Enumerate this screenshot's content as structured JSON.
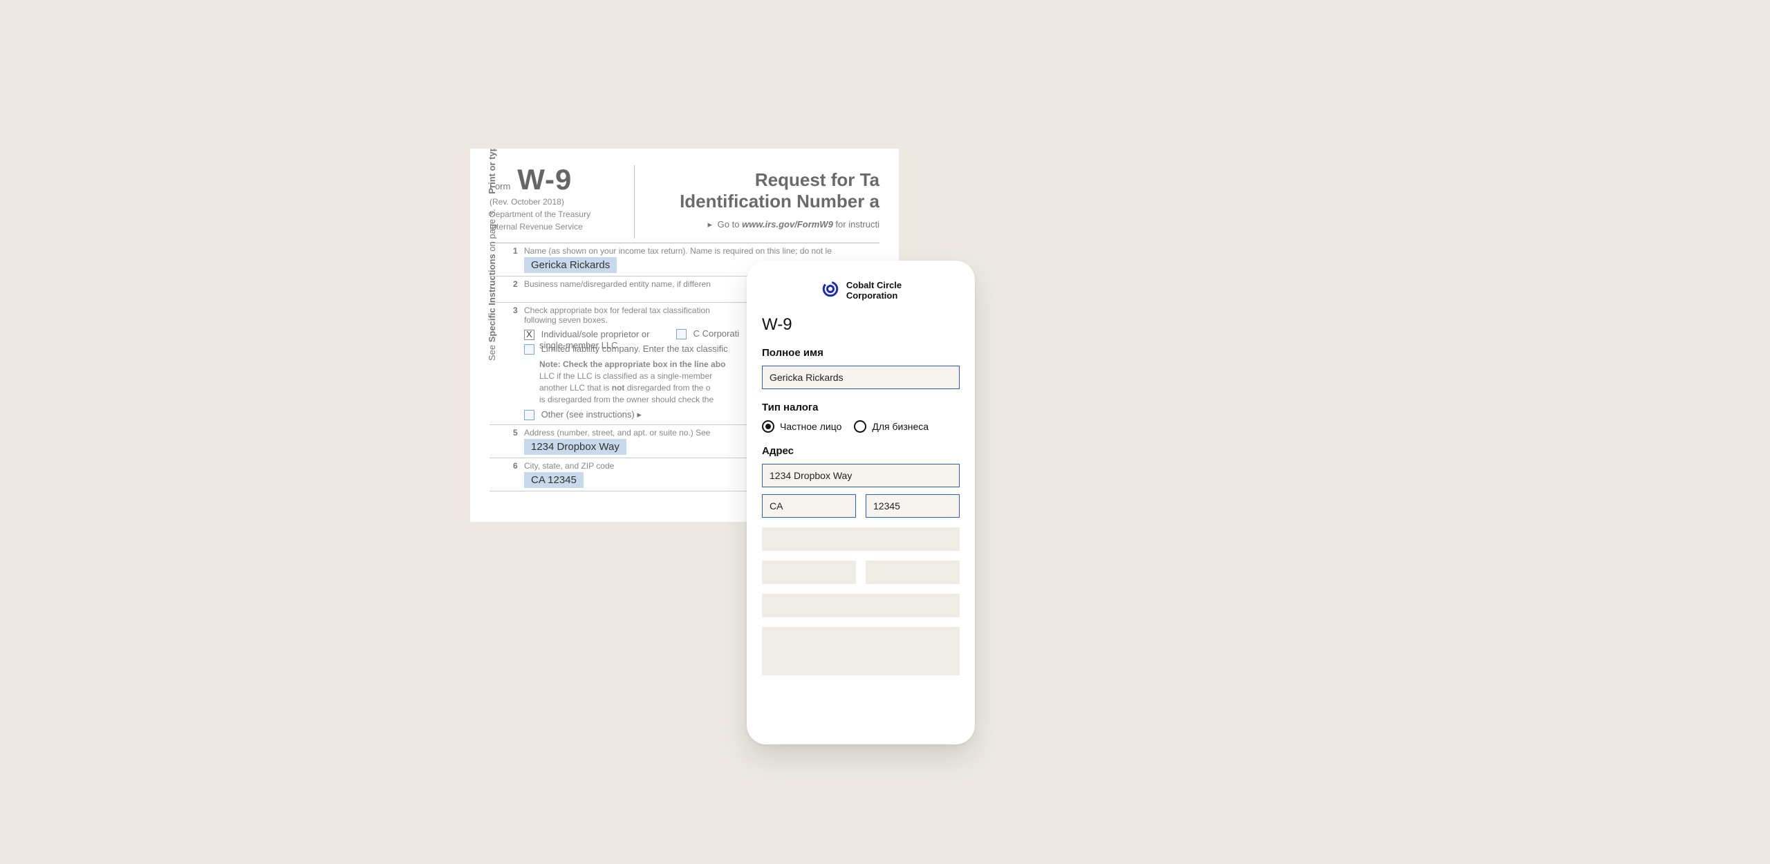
{
  "paper": {
    "form_label": "Form",
    "code": "W-9",
    "rev": "(Rev. October 2018)",
    "dept1": "Department of the Treasury",
    "dept2": "Internal Revenue Service",
    "title1": "Request for Ta",
    "title2": "Identification Number a",
    "goto_prefix": "Go to",
    "goto_url": "www.irs.gov/FormW9",
    "goto_suffix": "for instructi",
    "sidecap_a": "See",
    "sidecap_b": "Specific Instructions",
    "sidecap_c": "on page 3.",
    "sidecap_d": "Print or type.",
    "row1_label": "Name (as shown on your income tax return). Name is required on this line; do not le",
    "row1_value": "Gericka Rickards",
    "row2_label": "Business name/disregarded entity name, if differen",
    "row3_label": "Check appropriate box for federal tax classification",
    "row3_label2": "following seven boxes.",
    "opt_individual": "Individual/sole proprietor or",
    "opt_individual2": "single-member LLC",
    "opt_ccorp": "C Corporati",
    "opt_llc": "Limited liability company. Enter the tax classific",
    "note": "Note: Check the appropriate box in the line abo",
    "note2": "LLC if the LLC is classified as a single-member",
    "note3a": "another LLC that is",
    "note3b": "not",
    "note3c": "disregarded from the o",
    "note4": "is disregarded from the owner should check the",
    "opt_other": "Other (see instructions) ▸",
    "row5_label": "Address (number, street, and apt. or suite no.) See",
    "row5_value": "1234 Dropbox Way",
    "row6_label": "City, state, and ZIP code",
    "row6_value": "CA 12345"
  },
  "card": {
    "brand_line1": "Cobalt Circle",
    "brand_line2": "Corporation",
    "doc_title": "W-9",
    "label_fullname": "Полное имя",
    "value_fullname": "Gericka Rickards",
    "label_taxtype": "Тип налога",
    "radio_personal": "Частное лицо",
    "radio_business": "Для бизнеса",
    "label_address": "Адрес",
    "value_street": "1234 Dropbox Way",
    "value_state": "CA",
    "value_zip": "12345"
  }
}
